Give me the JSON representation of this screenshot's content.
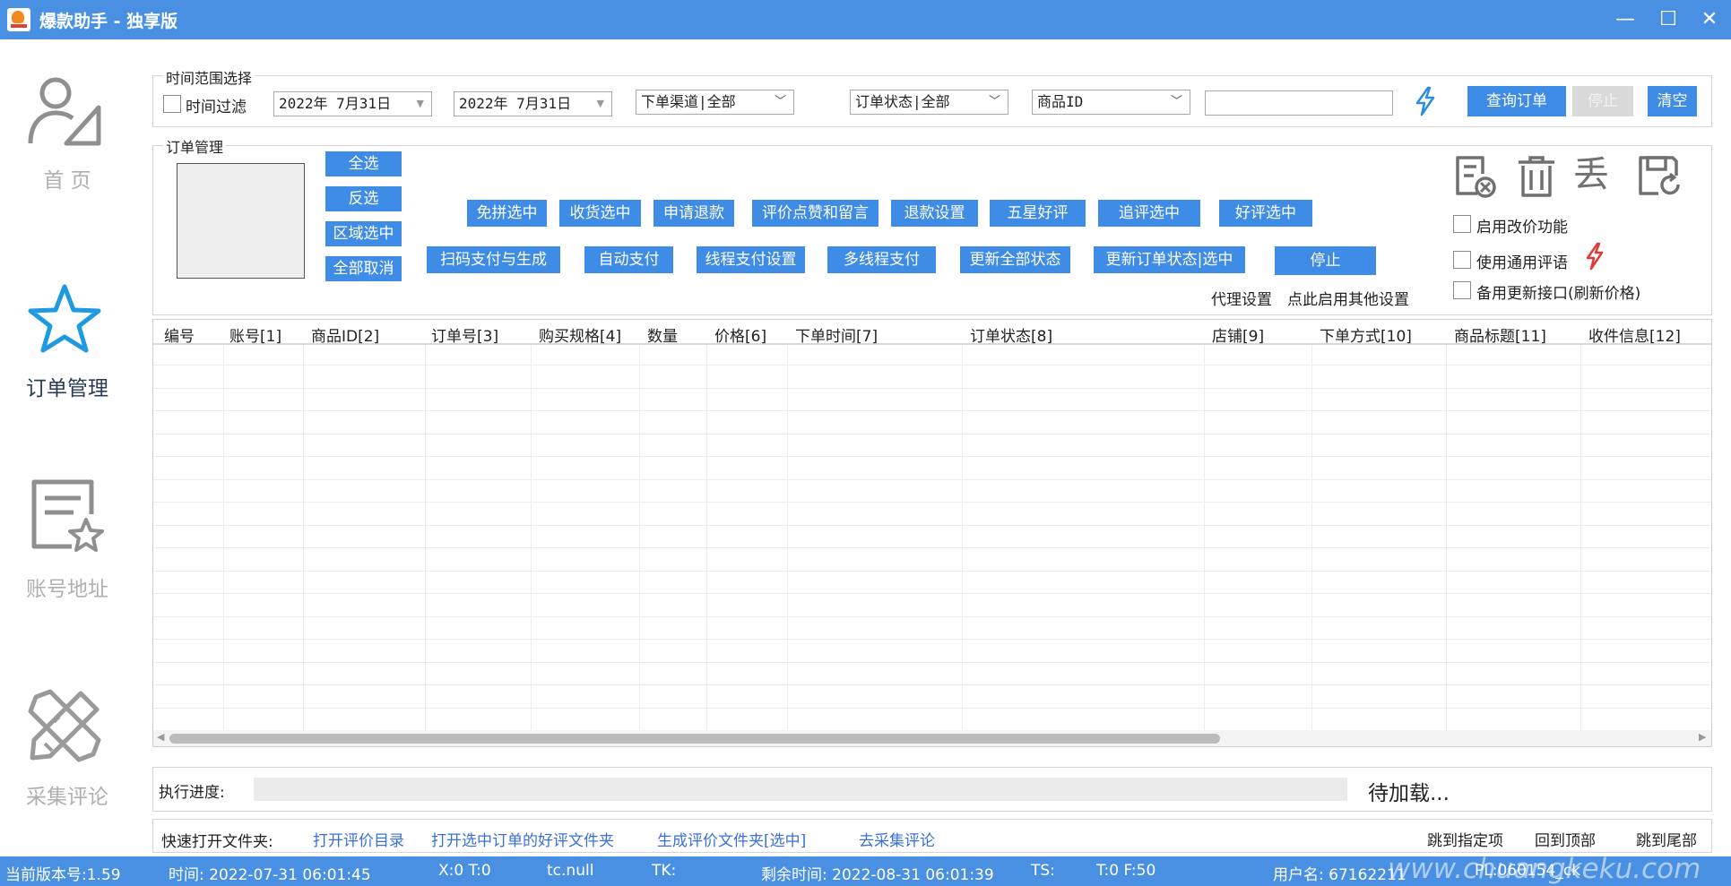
{
  "window": {
    "title": "爆款助手 - 独享版",
    "controls": {
      "minimize": "—",
      "maximize": "☐",
      "close": "✕"
    }
  },
  "sidebar": {
    "items": [
      {
        "label": "首 页",
        "icon": "user-icon"
      },
      {
        "label": "订单管理",
        "icon": "star-icon",
        "active": true
      },
      {
        "label": "账号地址",
        "icon": "document-star-icon"
      },
      {
        "label": "采集评论",
        "icon": "pencil-ruler-icon"
      }
    ]
  },
  "time_range": {
    "title": "时间范围选择",
    "time_filter_label": "时间过滤",
    "date_start": "2022年 7月31日",
    "date_end": "2022年 7月31日",
    "channel": "下单渠道|全部",
    "order_status": "订单状态|全部",
    "search_type": "商品ID",
    "search_value": "",
    "query_button": "查询订单",
    "stop_button": "停止",
    "clear_button": "清空"
  },
  "order_mgmt": {
    "title": "订单管理",
    "select_buttons": [
      "全选",
      "反选",
      "区域选中",
      "全部取消"
    ],
    "row1_buttons": [
      "免拼选中",
      "收货选中",
      "申请退款",
      "评价点赞和留言",
      "退款设置",
      "五星好评",
      "追评选中",
      "好评选中"
    ],
    "row2_buttons": [
      "扫码支付与生成",
      "自动支付",
      "线程支付设置",
      "多线程支付",
      "更新全部状态",
      "更新订单状态|选中",
      "停止"
    ],
    "proxy_link": "代理设置",
    "other_settings_link": "点此启用其他设置",
    "toolbar_icons": [
      "document-cancel-icon",
      "trash-icon",
      "discard-icon",
      "save-refresh-icon"
    ],
    "discard_glyph": "丢",
    "options": [
      {
        "label": "启用改价功能",
        "checked": false
      },
      {
        "label": "使用通用评语",
        "checked": false
      },
      {
        "label": "备用更新接口(刷新价格)",
        "checked": false
      }
    ]
  },
  "table": {
    "columns": [
      "编号",
      "账号[1]",
      "商品ID[2]",
      "订单号[3]",
      "购买规格[4]",
      "数量",
      "价格[6]",
      "下单时间[7]",
      "订单状态[8]",
      "店铺[9]",
      "下单方式[10]",
      "商品标题[11]",
      "收件信息[12]"
    ],
    "rows": []
  },
  "progress": {
    "label": "执行进度:",
    "value": 0,
    "status": "待加载..."
  },
  "quick_open": {
    "label": "快速打开文件夹:",
    "links": [
      "打开评价目录",
      "打开选中订单的好评文件夹",
      "生成评价文件夹[选中]",
      "去采集评论"
    ],
    "nav": [
      "跳到指定项",
      "回到顶部",
      "跳到尾部"
    ]
  },
  "status_bar": {
    "version": "当前版本号:1.59",
    "time": "时间: 2022-07-31 06:01:45",
    "xt": "X:0 T:0",
    "tc": "tc.null",
    "tk": "TK:",
    "remaining": "剩余时间: 2022-08-31 06:01:39",
    "ts": "TS:",
    "tf": "T:0 F:50",
    "username": "用户名: 67162211",
    "pl": "PL:060154_ck",
    "watermark": "www.chuangkeku.com"
  },
  "colors": {
    "accent": "#4a90e2",
    "button": "#3f8ce6",
    "link": "#3a6fd8",
    "lightning": "#e53935"
  }
}
